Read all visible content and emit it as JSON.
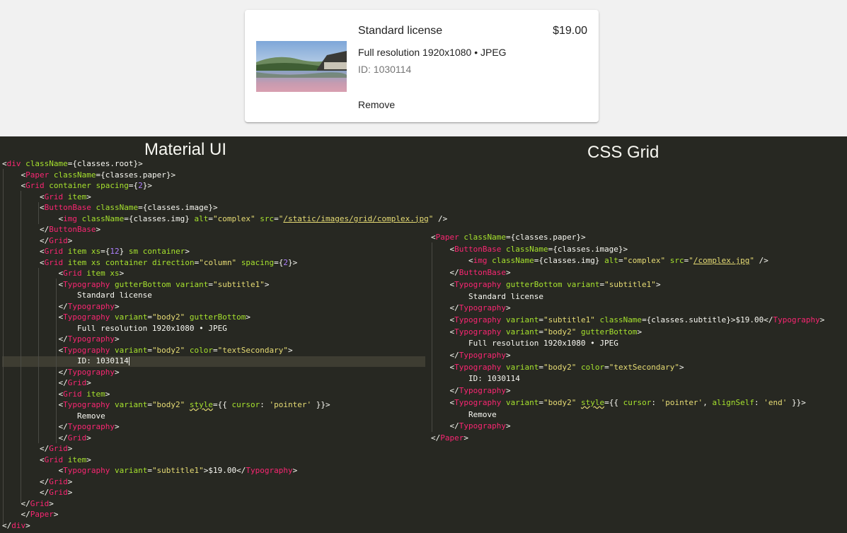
{
  "card": {
    "title": "Standard license",
    "price": "$19.00",
    "resolution": "Full resolution 1920x1080 • JPEG",
    "id_text": "ID: 1030114",
    "remove_label": "Remove"
  },
  "code_panel": {
    "left_heading": "Material UI",
    "right_heading": "CSS Grid"
  },
  "colors": {
    "editor_bg": "#272822",
    "tag": "#f92672",
    "attribute": "#a6e22e",
    "string": "#e6db74",
    "text": "#f8f8f2",
    "secondary_text": "#757575"
  }
}
